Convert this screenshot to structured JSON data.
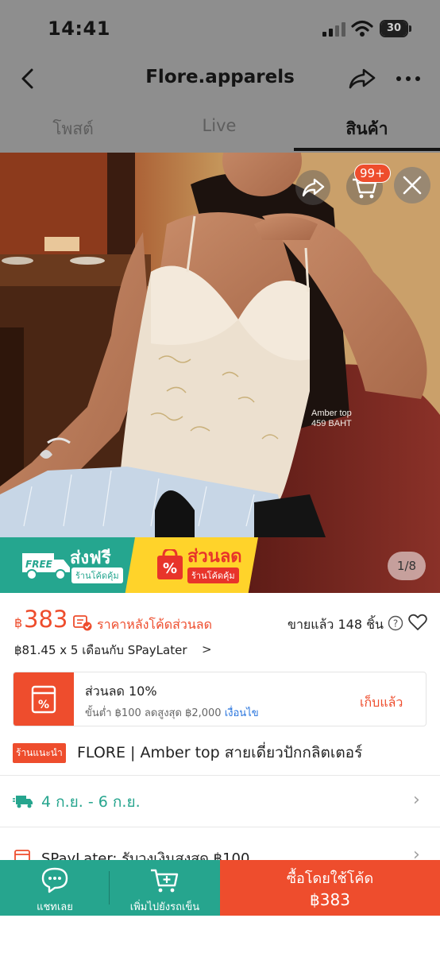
{
  "status_bar": {
    "time": "14:41",
    "battery": "30"
  },
  "nav": {
    "title": "Flore.apparels"
  },
  "tabs": [
    {
      "label": "โพสต์"
    },
    {
      "label": "Live"
    },
    {
      "label": "สินค้า"
    }
  ],
  "image": {
    "caption_line1": "Amber top",
    "caption_line2": "459 BAHT",
    "cart_badge": "99+",
    "counter": "1/8"
  },
  "promos": {
    "free_icon_text": "FREE",
    "free_main": "ส่งฟรี",
    "free_sub": "ร้านโค้ดคุ้ม",
    "sale_main": "ส่วนลด",
    "sale_sub": "ร้านโค้ดคุ้ม"
  },
  "price": {
    "currency": "฿",
    "value": "383",
    "note": "ราคาหลังโค้ดส่วนลด",
    "sold": "ขายแล้ว 148 ชิ้น",
    "paylater": "฿81.45 x 5 เดือนกับ SPayLater",
    "chevron": ">"
  },
  "voucher": {
    "title": "ส่วนลด 10%",
    "condition": "ขั้นต่ำ ฿100 ลดสูงสุด ฿2,000",
    "terms": "เงื่อนไข",
    "claim": "เก็บแล้ว"
  },
  "product": {
    "tag": "ร้านแนะนำ",
    "title": "FLORE | Amber top สายเดี่ยวปักกลิตเตอร์"
  },
  "shipping": {
    "date": "4 ก.ย. - 6 ก.ย.",
    "chevron": "›"
  },
  "spaylater_row": {
    "text": "SPayLater: รับวงเงินสูงสุด ฿100",
    "chevron": "›"
  },
  "bottom_bar": {
    "chat": "แชทเลย",
    "add_to_cart": "เพิ่มไปยังรถเข็น",
    "buy_label": "ซื้อโดยใช้โค้ด",
    "buy_price": "฿383"
  },
  "colors": {
    "brand": "#ee4d2d",
    "teal": "#26a58e",
    "promo_yellow": "#ffd32a"
  }
}
